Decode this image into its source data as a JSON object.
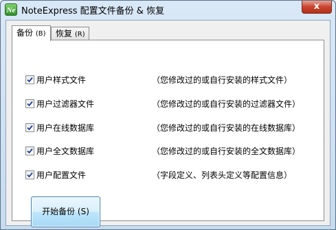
{
  "window": {
    "icon_text": "Ne",
    "title": "NoteExpress 配置文件备份 & 恢复",
    "close_glyph": "x"
  },
  "tabs": [
    {
      "label": "备份",
      "key": "(B)",
      "active": true
    },
    {
      "label": "恢复",
      "key": "(R)",
      "active": false
    }
  ],
  "options": [
    {
      "label": "用户样式文件",
      "description": "（您修改过的或自行安装的样式文件）",
      "checked": true
    },
    {
      "label": "用户过滤器文件",
      "description": "（您修改过的或自行安装的过滤器文件）",
      "checked": true
    },
    {
      "label": "用户在线数据库",
      "description": "（您修改过的或自行安装的在线数据库）",
      "checked": true
    },
    {
      "label": "用户全文数据库",
      "description": "（您修改过的或自行安装的全文数据库）",
      "checked": true
    },
    {
      "label": "用户配置文件",
      "description": "（字段定义、列表头定义等配置信息）",
      "checked": true
    }
  ],
  "start_button": {
    "label": "开始备份 (S)"
  }
}
